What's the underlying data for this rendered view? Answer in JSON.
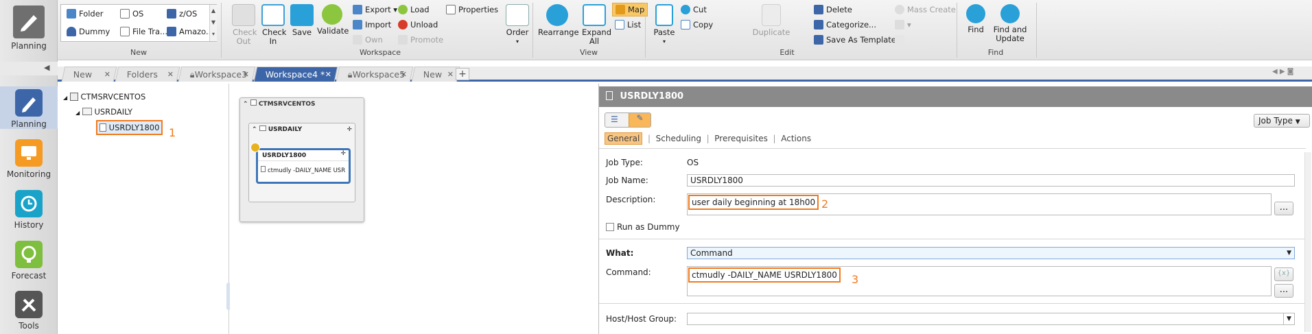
{
  "sidebar": {
    "top_label": "Planning",
    "items": [
      {
        "label": "Planning",
        "icon": "pencil-icon",
        "color": "#3d66a8"
      },
      {
        "label": "Monitoring",
        "icon": "monitor-icon",
        "color": "#f59a23"
      },
      {
        "label": "History",
        "icon": "history-icon",
        "color": "#1aa3c9"
      },
      {
        "label": "Forecast",
        "icon": "forecast-icon",
        "color": "#7fbf3f"
      },
      {
        "label": "Tools",
        "icon": "tools-icon",
        "color": "#555555"
      }
    ]
  },
  "ribbon": {
    "new_group": {
      "label": "New",
      "items": [
        "Folder",
        "OS",
        "z/OS",
        "Dummy",
        "File Tra...",
        "Amazo..."
      ]
    },
    "workspace_group": {
      "label": "Workspace",
      "check_out": "Check Out",
      "check_in": "Check In",
      "save": "Save",
      "validate": "Validate",
      "export": "Export",
      "import": "Import",
      "own": "Own",
      "load": "Load",
      "unload": "Unload",
      "promote": "Promote",
      "properties": "Properties",
      "order": "Order"
    },
    "view_group": {
      "label": "View",
      "rearrange": "Rearrange",
      "expand_all": "Expand All",
      "map": "Map",
      "list": "List"
    },
    "edit_group": {
      "label": "Edit",
      "paste": "Paste",
      "cut": "Cut",
      "copy": "Copy",
      "duplicate": "Duplicate",
      "delete": "Delete",
      "categorize": "Categorize...",
      "save_as_template": "Save As Template",
      "mass_create": "Mass Create"
    },
    "find_group": {
      "label": "Find",
      "find": "Find",
      "find_and_update": "Find and Update"
    }
  },
  "tabs": [
    {
      "label": "New",
      "active": false
    },
    {
      "label": "Folders",
      "active": false
    },
    {
      "label": "Workspace3",
      "active": false
    },
    {
      "label": "Workspace4 *",
      "active": true
    },
    {
      "label": "Workspace5",
      "active": false
    },
    {
      "label": "New",
      "active": false
    }
  ],
  "tree": {
    "server": "CTMSRVCENTOS",
    "folder": "USRDAILY",
    "job": "USRDLY1800",
    "marker": "1"
  },
  "map": {
    "server": "CTMSRVCENTOS",
    "folder": "USRDAILY",
    "job": "USRDLY1800",
    "command_preview": "ctmudly -DAILY_NAME USR"
  },
  "detail": {
    "title": "USRDLY1800",
    "job_type_button": "Job Type",
    "subtabs": [
      "General",
      "Scheduling",
      "Prerequisites",
      "Actions"
    ],
    "job_type_label": "Job Type:",
    "job_type_value": "OS",
    "job_name_label": "Job Name:",
    "job_name_value": "USRDLY1800",
    "description_label": "Description:",
    "description_value": "user daily beginning at 18h00",
    "description_marker": "2",
    "run_as_dummy": "Run as Dummy",
    "what_label": "What:",
    "what_value": "Command",
    "command_label": "Command:",
    "command_value": "ctmudly -DAILY_NAME USRDLY1800",
    "command_marker": "3",
    "host_label": "Host/Host Group:",
    "host_value": "",
    "ellipsis": "...",
    "var_button": "{x}"
  },
  "colors": {
    "accent_blue": "#3d66a8",
    "highlight_orange": "#f07a1e"
  }
}
